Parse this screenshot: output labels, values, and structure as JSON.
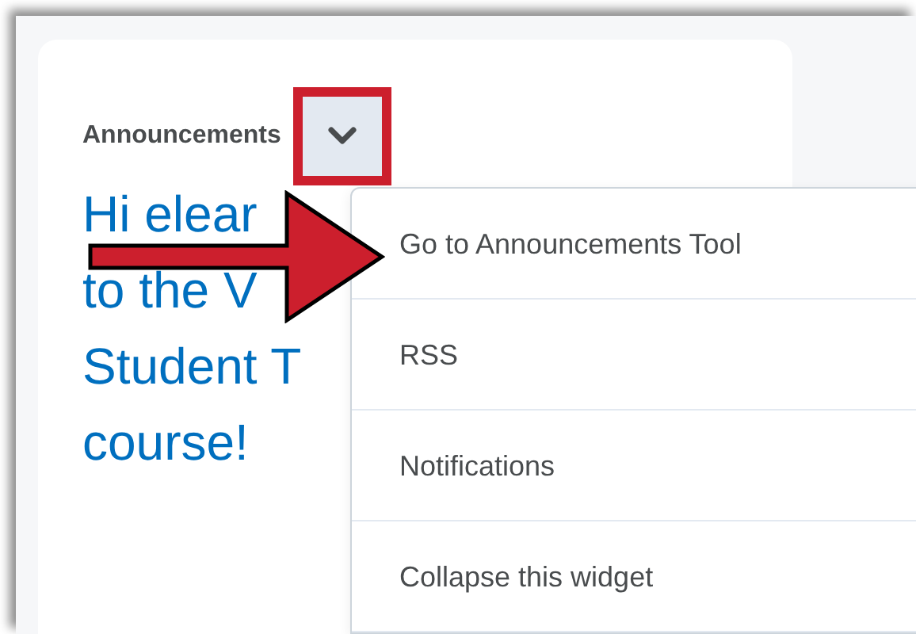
{
  "widget": {
    "title": "Announcements",
    "menu_button": {
      "expanded": true,
      "highlighted": true
    },
    "headline_lines": [
      "Hi elear",
      "to the V",
      "Student T",
      "course!"
    ]
  },
  "menu": {
    "items": [
      {
        "label": "Go to Announcements Tool",
        "pointed": true
      },
      {
        "label": "RSS",
        "pointed": false
      },
      {
        "label": "Notifications",
        "pointed": false
      },
      {
        "label": "Collapse this widget",
        "pointed": false
      }
    ]
  }
}
